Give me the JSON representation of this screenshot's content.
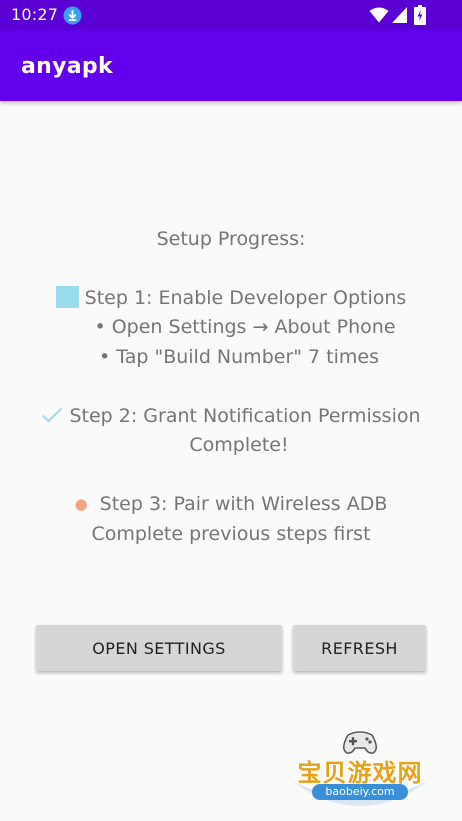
{
  "status_bar": {
    "time": "10:27",
    "icons": [
      "download-icon",
      "wifi-icon",
      "signal-icon",
      "battery-icon"
    ]
  },
  "app_bar": {
    "title": "anyapk"
  },
  "setup": {
    "heading": "Setup Progress:",
    "step1": {
      "title": "Step 1: Enable Developer Options",
      "line1": "• Open Settings → About Phone",
      "line2": "• Tap \"Build Number\" 7 times"
    },
    "step2": {
      "title": "Step 2: Grant Notification Permission",
      "status": "Complete!"
    },
    "step3": {
      "title": "Step 3: Pair with Wireless ADB",
      "status": "Complete previous steps first"
    }
  },
  "buttons": {
    "open_settings": "OPEN SETTINGS",
    "refresh": "REFRESH"
  },
  "watermark": {
    "text": "宝贝游戏网",
    "url": "baobeiy.com"
  },
  "colors": {
    "status_bar": "#5a00d4",
    "app_bar": "#6200ee",
    "step1_icon": "#9adcef",
    "step2_check": "#a8d8e8",
    "step3_dot": "#f4a57e",
    "button": "#d6d6d6",
    "body_text": "#757575"
  }
}
